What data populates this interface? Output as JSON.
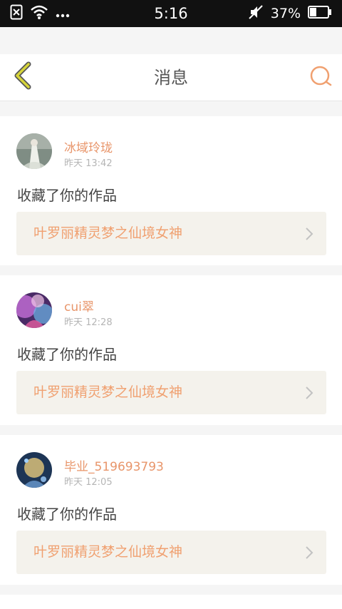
{
  "status_bar": {
    "time": "5:16",
    "battery_percent": "37%",
    "battery_level": 0.37
  },
  "navbar": {
    "title": "消息",
    "accent_color": "#f0a070"
  },
  "messages": [
    {
      "username": "冰域玲珑",
      "time": "昨天 13:42",
      "action": "收藏了你的作品",
      "work_title": "叶罗丽精灵梦之仙境女神"
    },
    {
      "username": "cui翠",
      "time": "昨天 12:28",
      "action": "收藏了你的作品",
      "work_title": "叶罗丽精灵梦之仙境女神"
    },
    {
      "username": "毕业_519693793",
      "time": "昨天 12:05",
      "action": "收藏了你的作品",
      "work_title": "叶罗丽精灵梦之仙境女神"
    }
  ],
  "colors": {
    "username": "#e8956a",
    "time": "#b5b5b5",
    "work_bg": "#f4f2ec",
    "work_title": "#f0a070",
    "back_arrow": "#d6d43a"
  }
}
